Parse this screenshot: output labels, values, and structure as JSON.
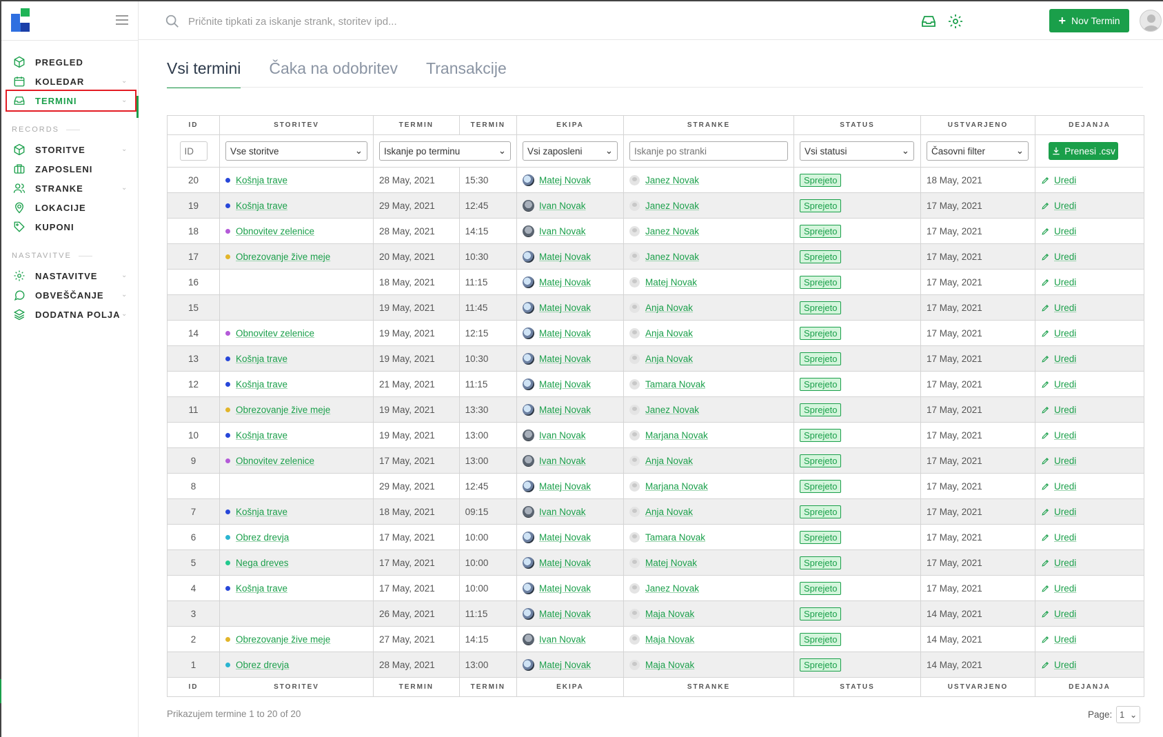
{
  "sidebar": {
    "items_main": [
      {
        "label": "PREGLED",
        "icon": "cube-icon"
      },
      {
        "label": "KOLEDAR",
        "icon": "calendar-icon",
        "chevron": true
      },
      {
        "label": "TERMINI",
        "icon": "inbox-icon",
        "chevron": true,
        "active": true
      }
    ],
    "section_records": "RECORDS",
    "items_records": [
      {
        "label": "STORITVE",
        "icon": "cube-icon",
        "chevron": true
      },
      {
        "label": "ZAPOSLENI",
        "icon": "briefcase-icon"
      },
      {
        "label": "STRANKE",
        "icon": "users-icon",
        "chevron": true
      },
      {
        "label": "LOKACIJE",
        "icon": "map-pin-icon"
      },
      {
        "label": "KUPONI",
        "icon": "tag-icon"
      }
    ],
    "section_settings": "NASTAVITVE",
    "items_settings": [
      {
        "label": "NASTAVITVE",
        "icon": "gear-icon",
        "chevron": true
      },
      {
        "label": "OBVEŠČANJE",
        "icon": "chat-icon",
        "chevron": true
      },
      {
        "label": "DODATNA POLJA",
        "icon": "layers-icon",
        "chevron": true
      }
    ]
  },
  "header": {
    "search_placeholder": "Pričnite tipkati za iskanje strank, storitev ipd...",
    "new_button": "Nov Termin"
  },
  "tabs": [
    "Vsi termini",
    "Čaka na odobritev",
    "Transakcije"
  ],
  "table": {
    "columns": [
      "ID",
      "STORITEV",
      "TERMIN",
      "TERMIN",
      "EKIPA",
      "STRANKE",
      "STATUS",
      "USTVARJENO",
      "DEJANJA"
    ],
    "filters": {
      "id_placeholder": "ID",
      "service": "Vse storitve",
      "date": "Iskanje po terminu",
      "employee": "Vsi zaposleni",
      "customer_placeholder": "Iskanje po stranki",
      "status": "Vsi statusi",
      "created": "Časovni filter",
      "csv": "Prenesi .csv"
    },
    "rows": [
      {
        "id": "20",
        "service": "Košnja trave",
        "color": "#2747d9",
        "date": "28 May, 2021",
        "time": "15:30",
        "employee": "Matej Novak",
        "customer": "Janez Novak",
        "status": "Sprejeto",
        "created": "18 May, 2021",
        "action": "Uredi"
      },
      {
        "id": "19",
        "service": "Košnja trave",
        "color": "#2747d9",
        "date": "29 May, 2021",
        "time": "12:45",
        "employee": "Ivan Novak",
        "customer": "Janez Novak",
        "status": "Sprejeto",
        "created": "17 May, 2021",
        "action": "Uredi"
      },
      {
        "id": "18",
        "service": "Obnovitev zelenice",
        "color": "#b45ad8",
        "date": "28 May, 2021",
        "time": "14:15",
        "employee": "Ivan Novak",
        "customer": "Janez Novak",
        "status": "Sprejeto",
        "created": "17 May, 2021",
        "action": "Uredi"
      },
      {
        "id": "17",
        "service": "Obrezovanje žive meje",
        "color": "#e2b52a",
        "date": "20 May, 2021",
        "time": "10:30",
        "employee": "Matej Novak",
        "customer": "Janez Novak",
        "status": "Sprejeto",
        "created": "17 May, 2021",
        "action": "Uredi"
      },
      {
        "id": "16",
        "service": "",
        "color": "",
        "date": "18 May, 2021",
        "time": "11:15",
        "employee": "Matej Novak",
        "customer": "Matej Novak",
        "status": "Sprejeto",
        "created": "17 May, 2021",
        "action": "Uredi"
      },
      {
        "id": "15",
        "service": "",
        "color": "",
        "date": "19 May, 2021",
        "time": "11:45",
        "employee": "Matej Novak",
        "customer": "Anja Novak",
        "status": "Sprejeto",
        "created": "17 May, 2021",
        "action": "Uredi"
      },
      {
        "id": "14",
        "service": "Obnovitev zelenice",
        "color": "#b45ad8",
        "date": "19 May, 2021",
        "time": "12:15",
        "employee": "Matej Novak",
        "customer": "Anja Novak",
        "status": "Sprejeto",
        "created": "17 May, 2021",
        "action": "Uredi"
      },
      {
        "id": "13",
        "service": "Košnja trave",
        "color": "#2747d9",
        "date": "19 May, 2021",
        "time": "10:30",
        "employee": "Matej Novak",
        "customer": "Anja Novak",
        "status": "Sprejeto",
        "created": "17 May, 2021",
        "action": "Uredi"
      },
      {
        "id": "12",
        "service": "Košnja trave",
        "color": "#2747d9",
        "date": "21 May, 2021",
        "time": "11:15",
        "employee": "Matej Novak",
        "customer": "Tamara Novak",
        "status": "Sprejeto",
        "created": "17 May, 2021",
        "action": "Uredi"
      },
      {
        "id": "11",
        "service": "Obrezovanje žive meje",
        "color": "#e2b52a",
        "date": "19 May, 2021",
        "time": "13:30",
        "employee": "Matej Novak",
        "customer": "Janez Novak",
        "status": "Sprejeto",
        "created": "17 May, 2021",
        "action": "Uredi"
      },
      {
        "id": "10",
        "service": "Košnja trave",
        "color": "#2747d9",
        "date": "19 May, 2021",
        "time": "13:00",
        "employee": "Ivan Novak",
        "customer": "Marjana Novak",
        "status": "Sprejeto",
        "created": "17 May, 2021",
        "action": "Uredi"
      },
      {
        "id": "9",
        "service": "Obnovitev zelenice",
        "color": "#b45ad8",
        "date": "17 May, 2021",
        "time": "13:00",
        "employee": "Ivan Novak",
        "customer": "Anja Novak",
        "status": "Sprejeto",
        "created": "17 May, 2021",
        "action": "Uredi"
      },
      {
        "id": "8",
        "service": "",
        "color": "",
        "date": "29 May, 2021",
        "time": "12:45",
        "employee": "Matej Novak",
        "customer": "Marjana Novak",
        "status": "Sprejeto",
        "created": "17 May, 2021",
        "action": "Uredi"
      },
      {
        "id": "7",
        "service": "Košnja trave",
        "color": "#2747d9",
        "date": "18 May, 2021",
        "time": "09:15",
        "employee": "Ivan Novak",
        "customer": "Anja Novak",
        "status": "Sprejeto",
        "created": "17 May, 2021",
        "action": "Uredi"
      },
      {
        "id": "6",
        "service": "Obrez drevja",
        "color": "#2bb5d1",
        "date": "17 May, 2021",
        "time": "10:00",
        "employee": "Matej Novak",
        "customer": "Tamara Novak",
        "status": "Sprejeto",
        "created": "17 May, 2021",
        "action": "Uredi"
      },
      {
        "id": "5",
        "service": "Nega dreves",
        "color": "#22c98e",
        "date": "17 May, 2021",
        "time": "10:00",
        "employee": "Matej Novak",
        "customer": "Matej Novak",
        "status": "Sprejeto",
        "created": "17 May, 2021",
        "action": "Uredi"
      },
      {
        "id": "4",
        "service": "Košnja trave",
        "color": "#2747d9",
        "date": "17 May, 2021",
        "time": "10:00",
        "employee": "Matej Novak",
        "customer": "Janez Novak",
        "status": "Sprejeto",
        "created": "17 May, 2021",
        "action": "Uredi"
      },
      {
        "id": "3",
        "service": "",
        "color": "",
        "date": "26 May, 2021",
        "time": "11:15",
        "employee": "Matej Novak",
        "customer": "Maja Novak",
        "status": "Sprejeto",
        "created": "14 May, 2021",
        "action": "Uredi"
      },
      {
        "id": "2",
        "service": "Obrezovanje žive meje",
        "color": "#e2b52a",
        "date": "27 May, 2021",
        "time": "14:15",
        "employee": "Ivan Novak",
        "customer": "Maja Novak",
        "status": "Sprejeto",
        "created": "14 May, 2021",
        "action": "Uredi"
      },
      {
        "id": "1",
        "service": "Obrez drevja",
        "color": "#2bb5d1",
        "date": "28 May, 2021",
        "time": "13:00",
        "employee": "Matej Novak",
        "customer": "Maja Novak",
        "status": "Sprejeto",
        "created": "14 May, 2021",
        "action": "Uredi"
      }
    ]
  },
  "footer": {
    "summary": "Prikazujem termine 1 to 20 of 20",
    "page_label": "Page:",
    "page_value": "1"
  },
  "colors": {
    "accent": "#1a9f4a",
    "active_outline": "#e31b23"
  }
}
